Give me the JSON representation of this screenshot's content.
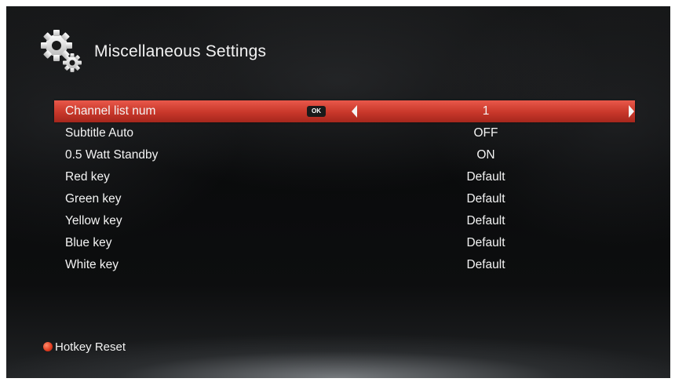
{
  "header": {
    "title": "Miscellaneous Settings",
    "icon": "gears-icon"
  },
  "menu": {
    "ok_label": "OK",
    "items": [
      {
        "label": "Channel list num",
        "value": "1",
        "selected": true
      },
      {
        "label": "Subtitle Auto",
        "value": "OFF"
      },
      {
        "label": "0.5 Watt Standby",
        "value": "ON"
      },
      {
        "label": "Red key",
        "value": "Default"
      },
      {
        "label": "Green key",
        "value": "Default"
      },
      {
        "label": "Yellow key",
        "value": "Default"
      },
      {
        "label": "Blue key",
        "value": "Default"
      },
      {
        "label": "White key",
        "value": "Default"
      }
    ]
  },
  "footer": {
    "hint_label": "Hotkey Reset",
    "hint_color": "#e03b1f"
  },
  "colors": {
    "highlight": "#d0402f",
    "background": "#0d0e0f"
  }
}
